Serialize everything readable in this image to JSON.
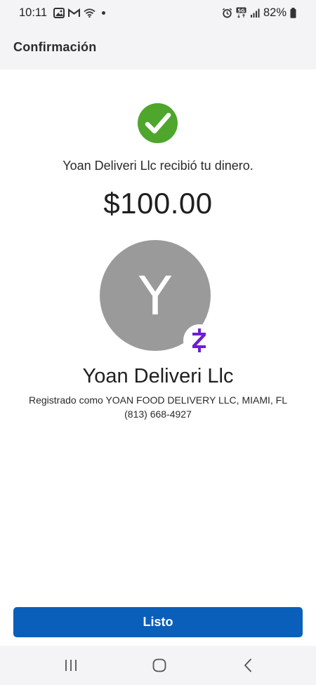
{
  "status_bar": {
    "time": "10:11",
    "battery": "82%",
    "network": "5G"
  },
  "header": {
    "title": "Confirmación"
  },
  "confirmation": {
    "message": "Yoan Deliveri Llc recibió tu dinero.",
    "amount": "$100.00",
    "success_icon": "check-icon",
    "success_color": "#4ea62c"
  },
  "recipient": {
    "avatar_letter": "Y",
    "name": "Yoan Deliveri Llc",
    "registered_as": "Registrado como YOAN FOOD DELIVERY LLC, MIAMI, FL",
    "phone": "(813) 668-4927",
    "badge_icon": "zelle-icon",
    "badge_color": "#6d1ed4"
  },
  "actions": {
    "done_label": "Listo",
    "button_color": "#0a5fba"
  },
  "nav": {
    "recents_icon": "recents-icon",
    "home_icon": "home-icon",
    "back_icon": "back-icon"
  }
}
